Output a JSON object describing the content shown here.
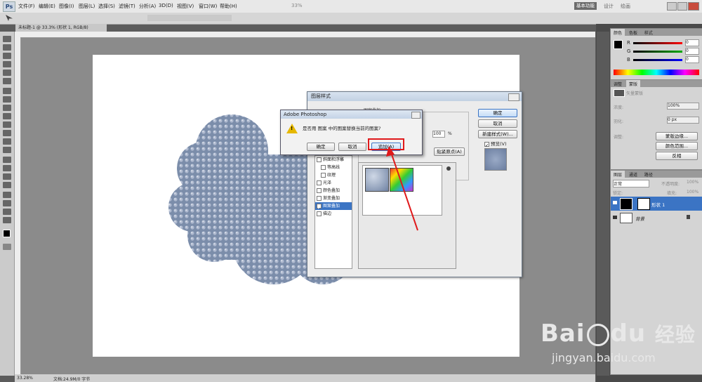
{
  "menubar": {
    "logo": "Ps",
    "items": [
      "文件(F)",
      "编辑(E)",
      "图像(I)",
      "图层(L)",
      "选择(S)",
      "滤镜(T)",
      "分析(A)",
      "3D(D)",
      "视图(V)",
      "窗口(W)",
      "帮助(H)"
    ],
    "zoom": "33%",
    "workspace": "基本功能",
    "workspace2": "设计",
    "workspace3": "绘画"
  },
  "document": {
    "tab_title": "未标题-1 @ 33.3% (形状 1, RGB/8)",
    "zoom_status": "33.28%",
    "doc_info": "文档:24.9M/0 字节"
  },
  "color_panel": {
    "tabs": [
      "颜色",
      "色板",
      "样式"
    ],
    "channels": [
      {
        "name": "R",
        "value": "0"
      },
      {
        "name": "G",
        "value": "0"
      },
      {
        "name": "B",
        "value": "0"
      }
    ]
  },
  "adjust_panel": {
    "tabs": [
      "调整",
      "蒙版"
    ],
    "label": "矢量蒙版",
    "density_label": "浓度:",
    "density_value": "100%",
    "feather_label": "羽化:",
    "feather_value": "0 px",
    "refine_label": "调整:",
    "buttons": [
      "蒙版边缘...",
      "颜色范围...",
      "反相"
    ]
  },
  "layers_panel": {
    "tabs": [
      "图层",
      "通道",
      "路径"
    ],
    "blend_mode": "正常",
    "opacity_label": "不透明度:",
    "opacity_value": "100%",
    "lock_label": "锁定:",
    "fill_label": "填充:",
    "fill_value": "100%",
    "layers": [
      {
        "name": "形状 1",
        "selected": true
      },
      {
        "name": "背景",
        "selected": false
      }
    ]
  },
  "layer_style_dialog": {
    "title": "图层样式",
    "section": "图案叠加",
    "opacity_value": "100",
    "opacity_unit": "%",
    "snap_button": "贴紧原点(A)",
    "buttons": {
      "ok": "确定",
      "cancel": "取消",
      "new_style": "新建样式(W)...",
      "preview": "预览(V)"
    },
    "styles": [
      {
        "label": "斜面和浮雕",
        "checked": false,
        "selected": false
      },
      {
        "label": "等高线",
        "checked": false,
        "selected": false
      },
      {
        "label": "纹理",
        "checked": false,
        "selected": false
      },
      {
        "label": "光泽",
        "checked": false,
        "selected": false
      },
      {
        "label": "颜色叠加",
        "checked": false,
        "selected": false
      },
      {
        "label": "渐变叠加",
        "checked": false,
        "selected": false
      },
      {
        "label": "图案叠加",
        "checked": true,
        "selected": true
      },
      {
        "label": "描边",
        "checked": false,
        "selected": false
      }
    ]
  },
  "message_box": {
    "title": "Adobe Photoshop",
    "message": "是否用 图案 中的图案替换当前的图案?",
    "ok": "确定",
    "cancel": "取消",
    "append": "追加(A)"
  },
  "watermark": {
    "brand": "Bai",
    "brand2": "du",
    "cn": "经验",
    "url": "jingyan.baidu.com"
  },
  "colors": {
    "highlight": "#e0191b",
    "pattern_fill": "#8093b3",
    "selection": "#3b74c4"
  }
}
